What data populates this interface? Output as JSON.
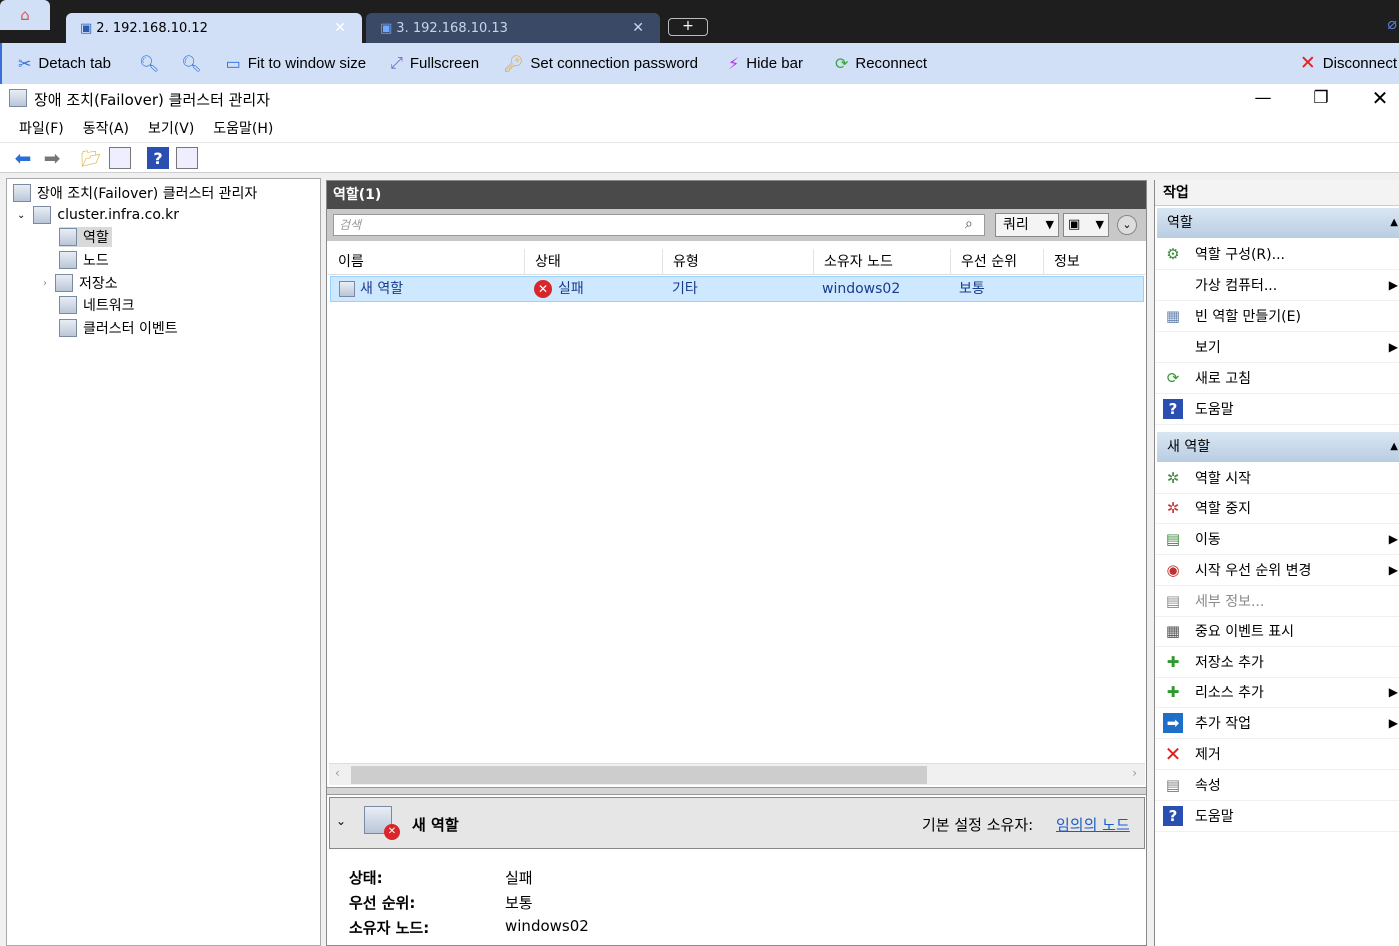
{
  "browser": {
    "tabs": [
      {
        "label": "2. 192.168.10.12"
      },
      {
        "label": "3. 192.168.10.13"
      }
    ],
    "add_tab": "+"
  },
  "rdbar": {
    "detach": "Detach tab",
    "fit": "Fit to window size",
    "fullscreen": "Fullscreen",
    "setpw": "Set connection password",
    "hidebar": "Hide bar",
    "reconnect": "Reconnect",
    "disconnect": "Disconnect"
  },
  "window": {
    "title": "장애 조치(Failover) 클러스터 관리자"
  },
  "menu": [
    "파일(F)",
    "동작(A)",
    "보기(V)",
    "도움말(H)"
  ],
  "tree": {
    "root": "장애 조치(Failover) 클러스터 관리자",
    "cluster": "cluster.infra.co.kr",
    "items": [
      "역할",
      "노드",
      "저장소",
      "네트워크",
      "클러스터 이벤트"
    ]
  },
  "center": {
    "header": "역할(1)",
    "search_placeholder": "검색",
    "query": "쿼리",
    "columns": [
      "이름",
      "상태",
      "유형",
      "소유자 노드",
      "우선 순위",
      "정보"
    ],
    "row": {
      "name": "새 역할",
      "status": "실패",
      "type": "기타",
      "owner": "windows02",
      "priority": "보통",
      "info": ""
    }
  },
  "detail": {
    "title": "새 역할",
    "owner_label": "기본 설정 소유자:",
    "owner_link": "임의의 노드",
    "fields": [
      {
        "label": "상태:",
        "value": "실패"
      },
      {
        "label": "우선 순위:",
        "value": "보통"
      },
      {
        "label": "소유자 노드:",
        "value": "windows02"
      }
    ]
  },
  "actions": {
    "title": "작업",
    "section1": "역할",
    "section1_items": [
      "역할 구성(R)...",
      "가상 컴퓨터...",
      "빈 역할 만들기(E)",
      "보기",
      "새로 고침",
      "도움말"
    ],
    "section2": "새 역할",
    "section2_items": [
      "역할 시작",
      "역할 중지",
      "이동",
      "시작 우선 순위 변경",
      "세부 정보...",
      "중요 이벤트 표시",
      "저장소 추가",
      "리소스 추가",
      "추가 작업",
      "제거",
      "속성",
      "도움말"
    ]
  }
}
